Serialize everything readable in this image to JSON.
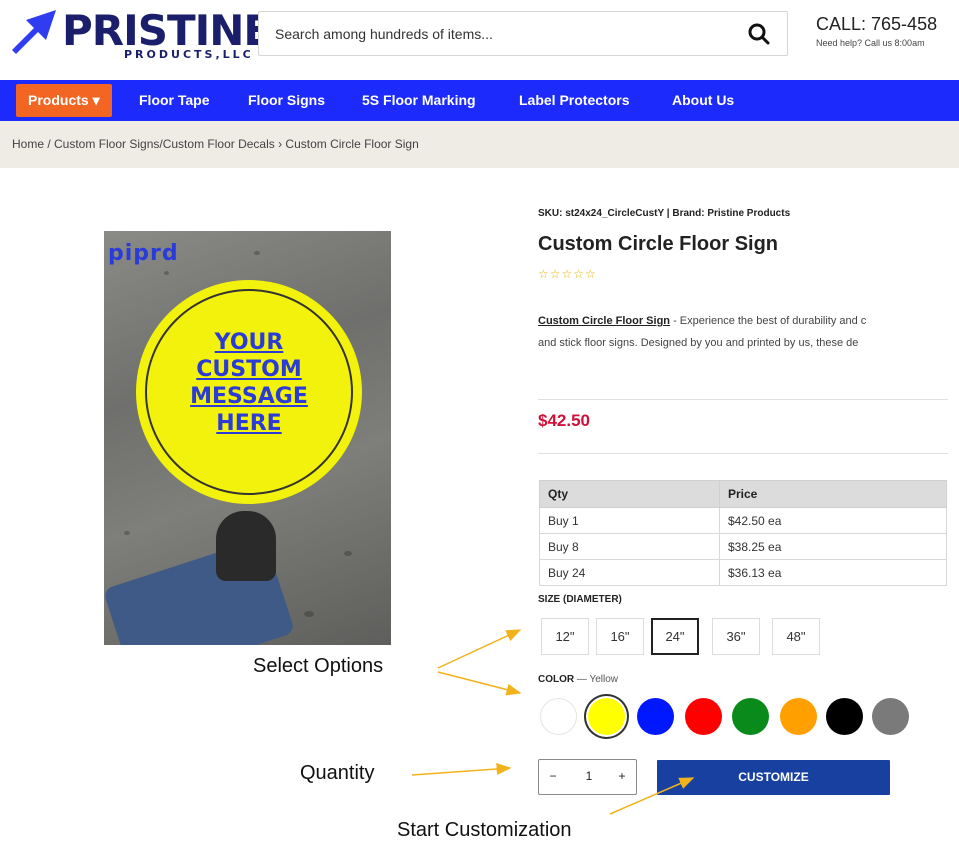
{
  "header": {
    "logo_main": "PRISTINE",
    "logo_sub": "PRODUCTS,LLC",
    "search_placeholder": "Search among hundreds of items...",
    "call": "CALL: 765-458",
    "help": "Need help? Call us 8:00am"
  },
  "nav": {
    "products": "Products ▾",
    "links": [
      "Floor Tape",
      "Floor Signs",
      "5S Floor Marking",
      "Label Protectors",
      "About Us"
    ]
  },
  "breadcrumb": "Home / Custom Floor Signs/Custom Floor Decals › Custom Circle Floor Sign",
  "image": {
    "watermark": "piprd",
    "circle_lines": [
      "YOUR",
      "CUSTOM",
      "MESSAGE",
      "HERE"
    ]
  },
  "product": {
    "sku": "SKU: st24x24_CircleCustY | Brand: Pristine Products",
    "title": "Custom Circle Floor Sign",
    "stars": "☆☆☆☆☆",
    "desc_link": "Custom Circle Floor Sign",
    "desc_rest1": " - Experience the best of durability and c",
    "desc_line2": "and stick floor signs. Designed by you and printed by us, these de",
    "price": "$42.50"
  },
  "price_table": {
    "headers": [
      "Qty",
      "Price"
    ],
    "rows": [
      [
        "Buy 1",
        "$42.50 ea"
      ],
      [
        "Buy 8",
        "$38.25 ea"
      ],
      [
        "Buy 24",
        "$36.13 ea"
      ]
    ]
  },
  "size": {
    "label": "SIZE (DIAMETER)",
    "options": [
      "12\"",
      "16\"",
      "24\"",
      "36\"",
      "48\""
    ],
    "selected": "24\""
  },
  "color": {
    "label": "COLOR",
    "selected_text": " — Yellow",
    "swatches": [
      "#ffffff",
      "#ffff00",
      "#0018ff",
      "#ff0000",
      "#0a8a1a",
      "#ffa000",
      "#000000",
      "#7a7a7a"
    ],
    "selected_index": 1
  },
  "quantity": {
    "minus": "−",
    "value": "1",
    "plus": "+"
  },
  "cta_label": "CUSTOMIZE",
  "annotations": {
    "select_options": "Select Options",
    "quantity": "Quantity",
    "start_customization": "Start Customization",
    "arrow_color": "#f2b21b"
  }
}
